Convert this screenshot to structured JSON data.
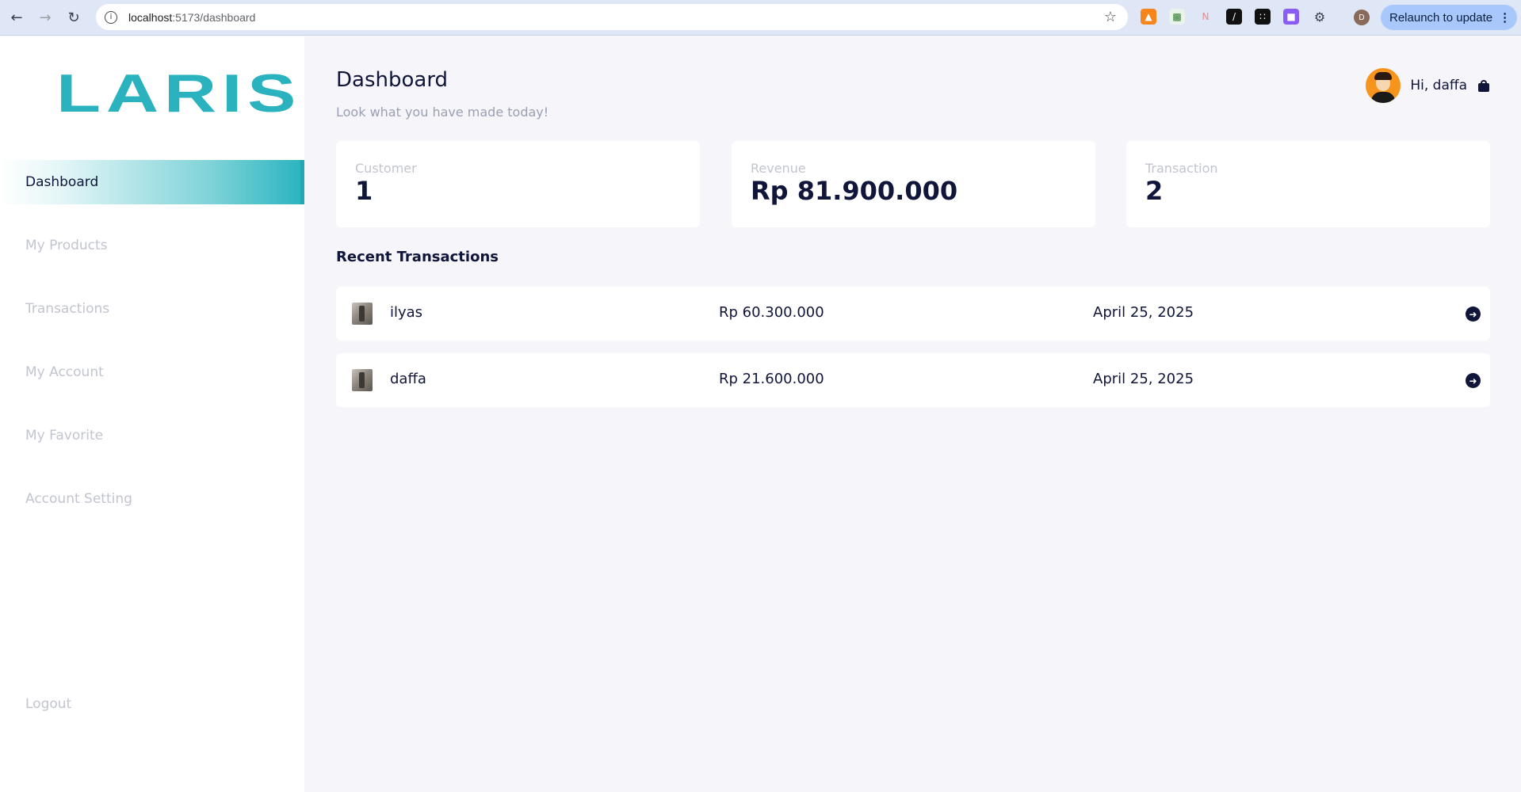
{
  "browser": {
    "url_host": "localhost",
    "url_path": ":5173/dashboard",
    "relaunch_label": "Relaunch to update",
    "profile_initial": "D"
  },
  "sidebar": {
    "logo": "LARIS",
    "items": [
      {
        "label": "Dashboard",
        "active": true
      },
      {
        "label": "My Products"
      },
      {
        "label": "Transactions"
      },
      {
        "label": "My Account"
      },
      {
        "label": "My Favorite"
      },
      {
        "label": "Account Setting"
      }
    ],
    "logout": "Logout"
  },
  "header": {
    "title": "Dashboard",
    "subtitle": "Look what you have made today!",
    "greeting": "Hi, daffa"
  },
  "stats": [
    {
      "label": "Customer",
      "value": "1"
    },
    {
      "label": "Revenue",
      "value": "Rp 81.900.000"
    },
    {
      "label": "Transaction",
      "value": "2"
    }
  ],
  "recent": {
    "title": "Recent Transactions",
    "rows": [
      {
        "name": "ilyas",
        "amount": "Rp 60.300.000",
        "date": "April 25, 2025"
      },
      {
        "name": "daffa",
        "amount": "Rp 21.600.000",
        "date": "April 25, 2025"
      }
    ]
  },
  "colors": {
    "accent": "#2ab3bf",
    "text": "#10153a",
    "muted": "#c2c4cf",
    "background": "#f5f5fa"
  }
}
